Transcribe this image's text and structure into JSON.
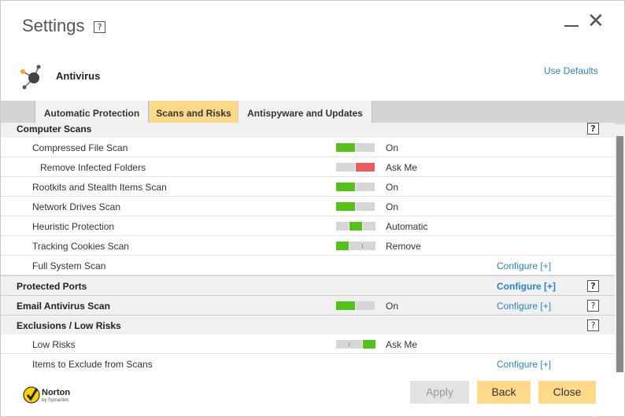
{
  "window": {
    "title": "Settings",
    "help": "?"
  },
  "header": {
    "section_title": "Antivirus",
    "use_defaults": "Use Defaults"
  },
  "tabs": [
    {
      "label": "Automatic Protection"
    },
    {
      "label": "Scans and Risks"
    },
    {
      "label": "Antispyware and Updates"
    }
  ],
  "rows": [
    {
      "label": "Computer Scans",
      "help": "?"
    },
    {
      "label": "Compressed File Scan",
      "status": "On"
    },
    {
      "label": "Remove Infected Folders",
      "status": "Ask Me"
    },
    {
      "label": "Rootkits and Stealth Items Scan",
      "status": "On"
    },
    {
      "label": "Network Drives Scan",
      "status": "On"
    },
    {
      "label": "Heuristic Protection",
      "status": "Automatic"
    },
    {
      "label": "Tracking Cookies Scan",
      "status": "Remove"
    },
    {
      "label": "Full System Scan",
      "configure": "Configure [+]"
    },
    {
      "label": "Protected Ports",
      "configure": "Configure [+]",
      "help": "?"
    },
    {
      "label": "Email Antivirus Scan",
      "status": "On",
      "configure": "Configure [+]",
      "help": "?"
    },
    {
      "label": "Exclusions / Low Risks",
      "help": "?"
    },
    {
      "label": "Low Risks",
      "status": "Ask Me"
    },
    {
      "label": "Items to Exclude from Scans",
      "configure": "Configure [+]"
    }
  ],
  "brand": {
    "name": "Norton",
    "by": "by Symantec"
  },
  "buttons": {
    "apply": "Apply",
    "back": "Back",
    "close": "Close"
  },
  "colors": {
    "accent": "#ffd98a",
    "on": "#55c21a",
    "ask": "#e85c5c",
    "link": "#2a84c8"
  }
}
